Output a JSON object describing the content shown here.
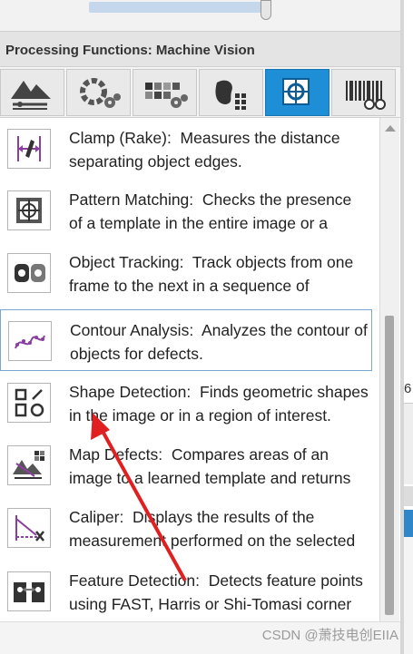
{
  "panel": {
    "title": "Processing Functions: Machine Vision"
  },
  "tabs": [
    {
      "icon": "terrain-tools-icon"
    },
    {
      "icon": "color-gears-icon"
    },
    {
      "icon": "grid-gears-icon"
    },
    {
      "icon": "blob-grid-icon"
    },
    {
      "icon": "target-tool-icon",
      "active": true
    },
    {
      "icon": "barcode-glasses-icon"
    }
  ],
  "functions": [
    {
      "name": "Clamp (Rake):",
      "desc": "Measures the distance separating object edges.",
      "icon": "clamp-icon"
    },
    {
      "name": "Pattern Matching:",
      "desc": "Checks the presence of a template in the entire image or a region of interest.",
      "icon": "pattern-match-icon"
    },
    {
      "name": "Object Tracking:",
      "desc": "Track objects from one frame to the next in a sequence of images.",
      "icon": "object-tracking-icon"
    },
    {
      "name": "Contour Analysis:",
      "desc": "Analyzes the contour of objects for defects.",
      "icon": "contour-analysis-icon",
      "selected": true
    },
    {
      "name": "Shape Detection:",
      "desc": "Finds geometric shapes in the image or in a region of interest.",
      "icon": "shape-detection-icon"
    },
    {
      "name": "Map Defects:",
      "desc": "Compares areas of an image to a learned template and returns the differences found in the image.",
      "icon": "map-defects-icon"
    },
    {
      "name": "Caliper:",
      "desc": "Displays the results of the measurement performed on the selected region.",
      "icon": "caliper-icon"
    },
    {
      "name": "Feature Detection:",
      "desc": "Detects feature points using FAST, Harris or Shi-Tomasi corner detectors.",
      "icon": "feature-detection-icon"
    }
  ],
  "right_pane": {
    "number_fragment": "6"
  },
  "watermark": "CSDN @萧技电创EIIA",
  "colors": {
    "active_tab": "#1e8fd6",
    "selection_border": "#7aa6d1",
    "annotation_arrow": "#e02020",
    "icon_purple": "#8a3fa0"
  }
}
